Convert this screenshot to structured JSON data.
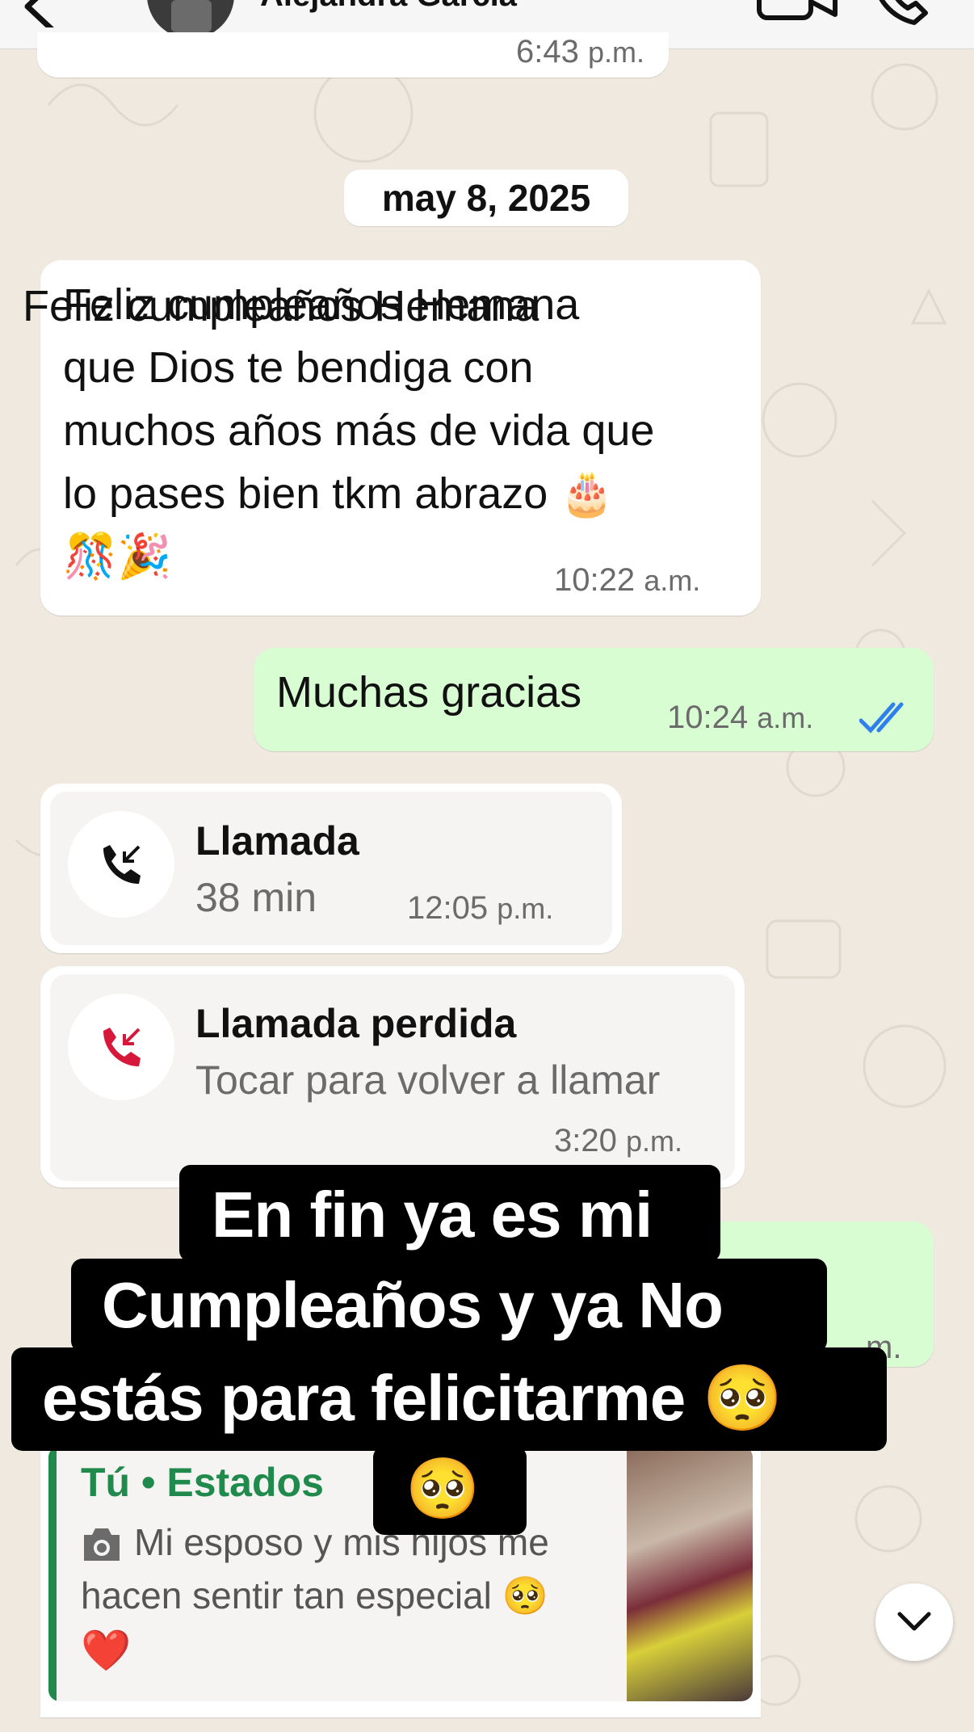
{
  "header": {
    "contact_name": "Alejandra García",
    "icons": [
      "back-chevron-icon",
      "video-camera-icon",
      "phone-icon"
    ]
  },
  "previous_message": {
    "time": "6:43",
    "ampm": "p.m."
  },
  "date_pill": "may 8, 2025",
  "messages": [
    {
      "direction": "incoming",
      "lines": [
        "Feliz cumpleaños Hemana",
        "que Dios te bendiga con",
        "muchos años más de vida que",
        "lo pases bien tkm abrazo 🎂",
        "🎊🎉"
      ],
      "time": "10:22",
      "ampm": "a.m."
    },
    {
      "direction": "outgoing",
      "text": "Muchas gracias",
      "time": "10:24",
      "ampm": "a.m.",
      "status": "read"
    }
  ],
  "calls": [
    {
      "title": "Llamada",
      "subtitle": "38 min",
      "time": "12:05",
      "ampm": "p.m.",
      "kind": "incoming",
      "icon_color": "#111111"
    },
    {
      "title": "Llamada perdida",
      "subtitle": "Tocar para volver a llamar",
      "time": "3:20",
      "ampm": "p.m.",
      "kind": "missed",
      "icon_color": "#d6183a"
    }
  ],
  "hidden_outgoing_time_fragment": "m.",
  "status_reply": {
    "source": "Tú • Estados",
    "text_line1": "Mi esposo y mis hijos me",
    "text_line2": "hacen sentir tan especial 🥺",
    "text_line3": "❤️",
    "accent": "#1f8a4c"
  },
  "overlay_caption": {
    "line1": "En fin ya es mi",
    "line2": "Cumpleaños y ya No",
    "line3": "estás para felicitarme 🥺",
    "line4": "🥺"
  },
  "colors": {
    "outgoing_bubble": "#d9fdd3",
    "read_ticks": "#2f80ed",
    "wallpaper": "#efe9e0"
  }
}
